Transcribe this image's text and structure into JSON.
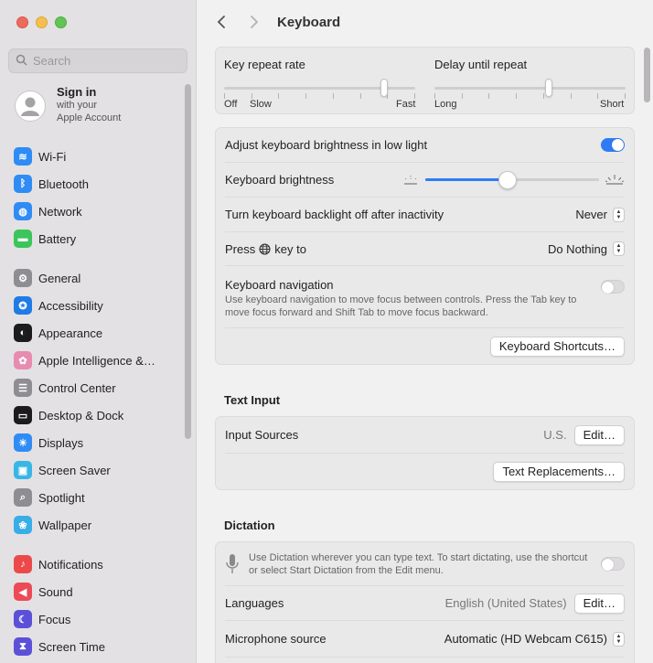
{
  "window": {
    "title": "Keyboard",
    "traffic_colors": [
      "#ed6a5e",
      "#f5bf4f",
      "#61c554"
    ]
  },
  "sidebar": {
    "search_placeholder": "Search",
    "account": {
      "line1": "Sign in",
      "line2": "with your",
      "line3": "Apple Account"
    },
    "groups": [
      [
        {
          "label": "Wi-Fi",
          "icon": "wifi-icon",
          "color": "#2f8cf5"
        },
        {
          "label": "Bluetooth",
          "icon": "bluetooth-icon",
          "color": "#2f8cf5"
        },
        {
          "label": "Network",
          "icon": "globe-icon",
          "color": "#2f8cf5"
        },
        {
          "label": "Battery",
          "icon": "battery-icon",
          "color": "#3bc55a"
        }
      ],
      [
        {
          "label": "General",
          "icon": "gear-icon",
          "color": "#8e8d92"
        },
        {
          "label": "Accessibility",
          "icon": "accessibility-icon",
          "color": "#1f7be6"
        },
        {
          "label": "Appearance",
          "icon": "appearance-icon",
          "color": "#1b1b1d"
        },
        {
          "label": "Apple Intelligence &…",
          "icon": "apple-intelligence-icon",
          "color": "#e88bb0"
        },
        {
          "label": "Control Center",
          "icon": "control-center-icon",
          "color": "#8e8d92"
        },
        {
          "label": "Desktop & Dock",
          "icon": "dock-icon",
          "color": "#1b1b1d"
        },
        {
          "label": "Displays",
          "icon": "sun-icon",
          "color": "#2f8cf5"
        },
        {
          "label": "Screen Saver",
          "icon": "screen-saver-icon",
          "color": "#38b6e6"
        },
        {
          "label": "Spotlight",
          "icon": "spotlight-icon",
          "color": "#8e8d92"
        },
        {
          "label": "Wallpaper",
          "icon": "flower-icon",
          "color": "#38aee6"
        }
      ],
      [
        {
          "label": "Notifications",
          "icon": "bell-icon",
          "color": "#ec4a4a"
        },
        {
          "label": "Sound",
          "icon": "speaker-icon",
          "color": "#ec4a57"
        },
        {
          "label": "Focus",
          "icon": "moon-icon",
          "color": "#5b51d8"
        },
        {
          "label": "Screen Time",
          "icon": "hourglass-icon",
          "color": "#5b51d8"
        }
      ]
    ]
  },
  "repeat": {
    "rate_label": "Key repeat rate",
    "rate_min": "Off",
    "rate_slow": "Slow",
    "rate_max": "Fast",
    "rate_level": 0.85,
    "delay_label": "Delay until repeat",
    "delay_min": "Long",
    "delay_max": "Short",
    "delay_level": 0.6
  },
  "brightness": {
    "adjust_label": "Adjust keyboard brightness in low light",
    "adjust_on": true,
    "level_label": "Keyboard brightness",
    "level": 0.47,
    "backlight_label": "Turn keyboard backlight off after inactivity",
    "backlight_value": "Never",
    "press_prefix": "Press",
    "press_suffix": "key to",
    "press_value": "Do Nothing",
    "nav_label": "Keyboard navigation",
    "nav_desc": "Use keyboard navigation to move focus between controls. Press the Tab key to move focus forward and Shift Tab to move focus backward.",
    "nav_on": false,
    "shortcuts_button": "Keyboard Shortcuts…"
  },
  "text_input": {
    "title": "Text Input",
    "sources_label": "Input Sources",
    "sources_value": "U.S.",
    "edit_button": "Edit…",
    "replacements_button": "Text Replacements…"
  },
  "dictation": {
    "title": "Dictation",
    "desc": "Use Dictation wherever you can type text. To start dictating, use the shortcut or select Start Dictation from the Edit menu.",
    "on": false,
    "languages_label": "Languages",
    "languages_value": "English (United States)",
    "edit_button": "Edit…",
    "mic_label": "Microphone source",
    "mic_value": "Automatic (HD Webcam C615)"
  },
  "accent": "#2f7bf5"
}
